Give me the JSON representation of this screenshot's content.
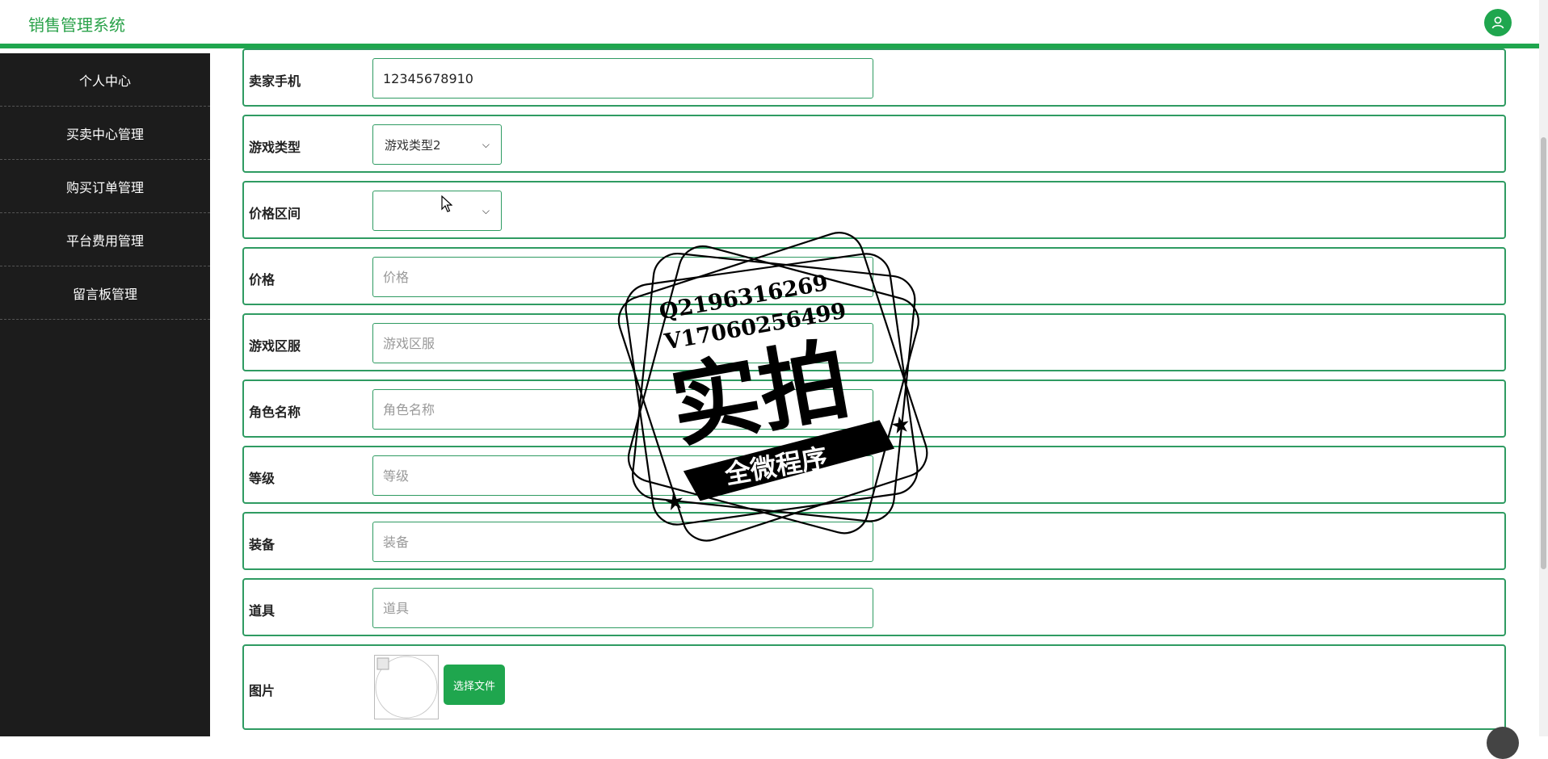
{
  "header": {
    "app_title": "销售管理系统",
    "user_icon": "user-icon"
  },
  "sidebar": {
    "items": [
      {
        "label": "个人中心"
      },
      {
        "label": "买卖中心管理"
      },
      {
        "label": "购买订单管理"
      },
      {
        "label": "平台费用管理"
      },
      {
        "label": "留言板管理"
      }
    ]
  },
  "form": {
    "seller_phone": {
      "label": "卖家手机",
      "value": "12345678910"
    },
    "game_type": {
      "label": "游戏类型",
      "selected": "游戏类型2"
    },
    "price_range": {
      "label": "价格区间",
      "selected": ""
    },
    "price": {
      "label": "价格",
      "placeholder": "价格"
    },
    "server": {
      "label": "游戏区服",
      "placeholder": "游戏区服"
    },
    "role_name": {
      "label": "角色名称",
      "placeholder": "角色名称"
    },
    "level": {
      "label": "等级",
      "placeholder": "等级"
    },
    "equipment": {
      "label": "装备",
      "placeholder": "装备"
    },
    "items": {
      "label": "道具",
      "placeholder": "道具"
    },
    "image": {
      "label": "图片",
      "choose_file": "选择文件"
    }
  },
  "watermark": {
    "qq": "Q2196316269",
    "wechat": "V17060256499",
    "main_text": "实拍",
    "banner_text": "全微程序"
  },
  "colors": {
    "accent": "#1fa64e",
    "sidebar_bg": "#1c1c1c",
    "border": "#2f9b62"
  }
}
